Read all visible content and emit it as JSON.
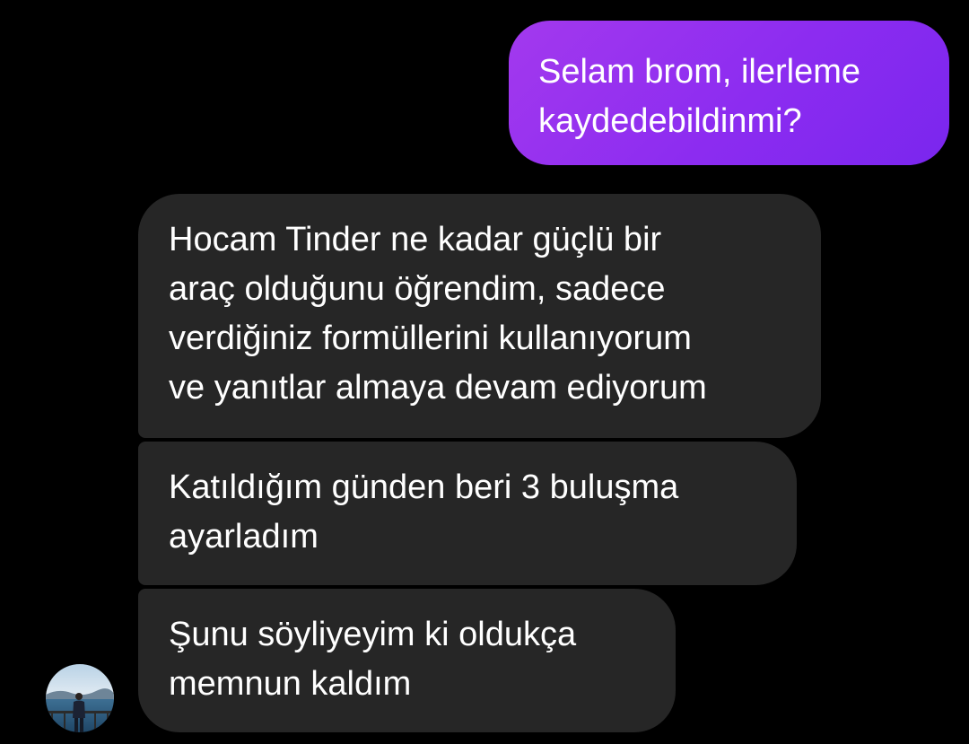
{
  "conversation": {
    "sent_messages": [
      {
        "text": "Selam brom, ilerleme\nkaydedebildinmi?"
      }
    ],
    "received_messages": [
      {
        "text": "Hocam Tinder ne kadar güçlü bir\naraç olduğunu öğrendim, sadece\nverdiğiniz formüllerini kullanıyorum\nve yanıtlar almaya devam ediyorum"
      },
      {
        "text": "Katıldığım günden beri 3 buluşma\nayarladım"
      },
      {
        "text": "Şunu söyliyeyim ki oldukça\nmemnun kaldım"
      }
    ],
    "sender_avatar": {
      "icon": "contact-avatar-photo"
    }
  },
  "colors": {
    "background": "#000000",
    "sent_bubble": "#8c2cf0",
    "received_bubble": "#262626",
    "text": "#ffffff"
  }
}
